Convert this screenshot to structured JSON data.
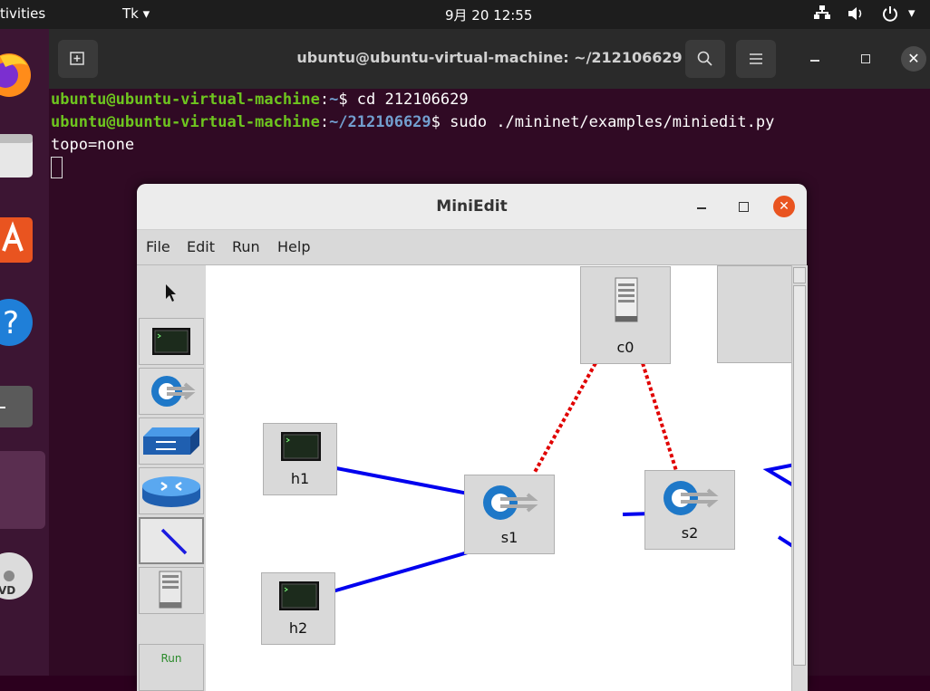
{
  "topbar": {
    "activities": "tivities",
    "app_menu": "Tk ▾",
    "clock": "9月 20 12:55",
    "system_icons": "network-icon, volume-icon, power-icon"
  },
  "terminal": {
    "title": "ubuntu@ubuntu-virtual-machine: ~/212106629",
    "lines": [
      {
        "user": "ubuntu@ubuntu-virtual-machine",
        "colon": ":",
        "path": "~",
        "prompt": "$ ",
        "cmd": "cd 212106629"
      },
      {
        "user": "ubuntu@ubuntu-virtual-machine",
        "colon": ":",
        "path": "~/212106629",
        "prompt": "$ ",
        "cmd": "sudo ./mininet/examples/miniedit.py"
      }
    ],
    "output": "topo=none"
  },
  "miniedit": {
    "title": "MiniEdit",
    "menus": [
      "File",
      "Edit",
      "Run",
      "Help"
    ],
    "run_label": "Run",
    "nodes": {
      "c0": "c0",
      "h1": "h1",
      "h2": "h2",
      "s1": "s1",
      "s2": "s2"
    }
  },
  "colors": {
    "link_blue": "#0000ee",
    "controller_link_red": "#e00000",
    "close_button": "#e95420"
  }
}
